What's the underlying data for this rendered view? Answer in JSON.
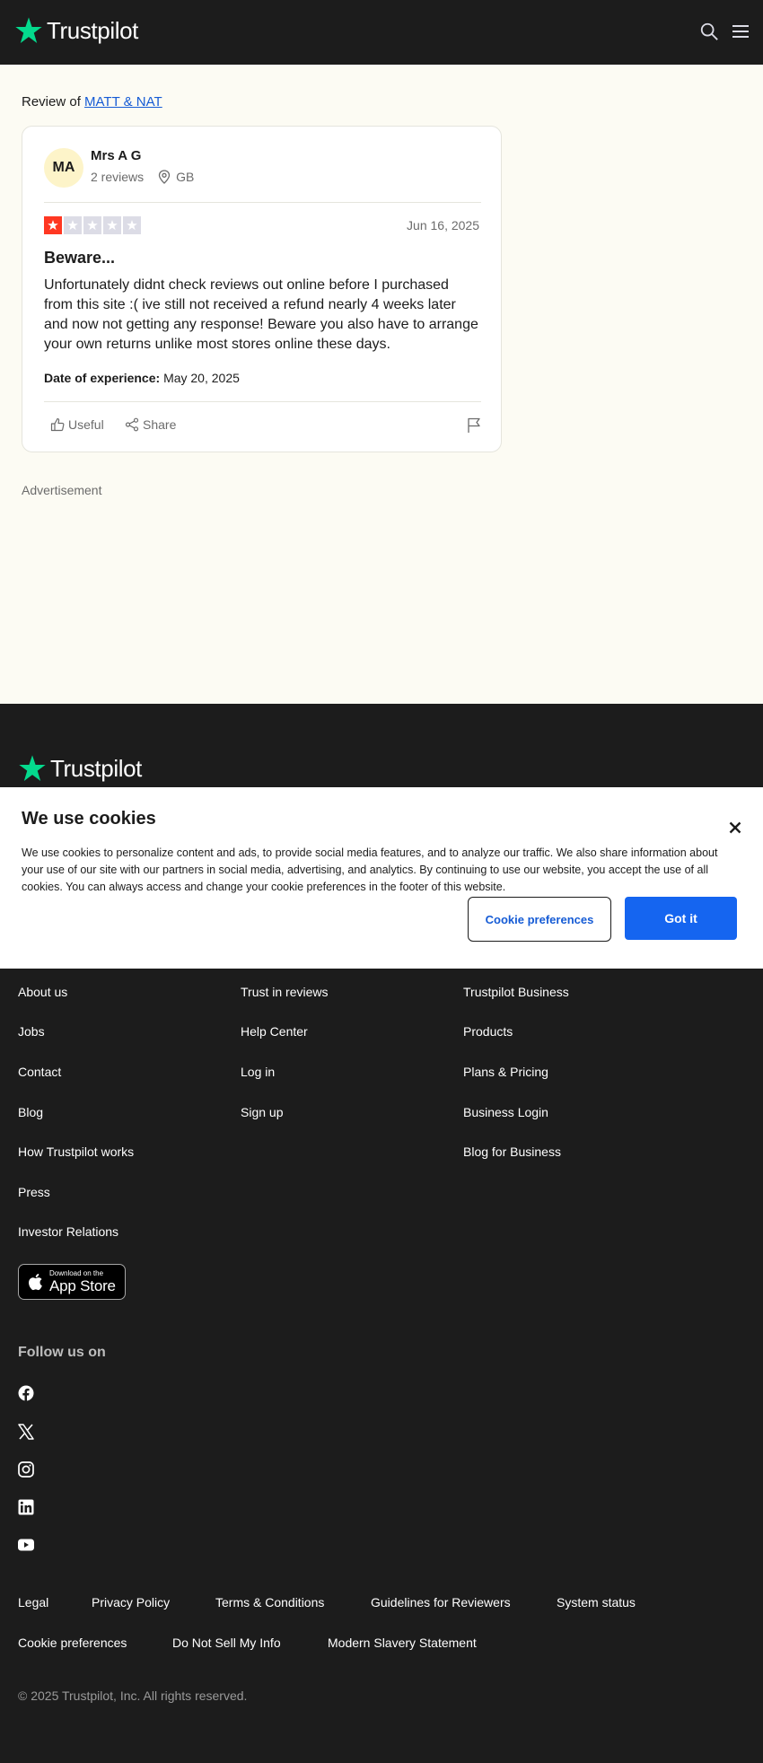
{
  "header": {
    "brand": "Trustpilot"
  },
  "review_of": {
    "prefix": "Review of",
    "company": "MATT & NAT"
  },
  "review": {
    "initials": "MA",
    "name": "Mrs A G",
    "reviews_count": "2 reviews",
    "location": "GB",
    "rating": 1,
    "date": "Jun 16, 2025",
    "title": "Beware...",
    "body": "Unfortunately didnt check reviews out online before I purchased from this site :( ive still not received a refund nearly 4 weeks later and now not getting any response! Beware you also have to arrange your own returns unlike most stores online these days.",
    "experience_label": "Date of experience:",
    "experience_date": "May 20, 2025",
    "useful_label": "Useful",
    "share_label": "Share"
  },
  "advertisement_label": "Advertisement",
  "cookie": {
    "title": "We use cookies",
    "text": "We use cookies to personalize content and ads, to provide social media features, and to analyze our traffic. We also share information about your use of our site with our partners in social media, advertising, and analytics. By continuing to use our website, you accept the use of all cookies. You can always access and change your cookie preferences in the footer of this website.",
    "prefs_label": "Cookie preferences",
    "accept_label": "Got it"
  },
  "footer": {
    "brand": "Trustpilot",
    "col1": [
      "About us",
      "Jobs",
      "Contact",
      "Blog",
      "How Trustpilot works",
      "Press",
      "Investor Relations"
    ],
    "col2": [
      "Trust in reviews",
      "Help Center",
      "Log in",
      "Sign up"
    ],
    "col3": [
      "Trustpilot Business",
      "Products",
      "Plans & Pricing",
      "Business Login",
      "Blog for Business"
    ],
    "appstore_small": "Download on the",
    "appstore_big": "App Store",
    "follow_label": "Follow us on",
    "bottom_row1": [
      "Legal",
      "Privacy Policy",
      "Terms & Conditions",
      "Guidelines for Reviewers",
      "System status"
    ],
    "bottom_row2": [
      "Cookie preferences",
      "Do Not Sell My Info",
      "Modern Slavery Statement"
    ],
    "copyright": "© 2025 Trustpilot, Inc. All rights reserved."
  },
  "colors": {
    "brand_green": "#04da8d",
    "star_red": "#ff3722",
    "link_blue": "#155bd5",
    "button_blue": "#1565f0",
    "footer_bg": "#1c1c1c"
  }
}
